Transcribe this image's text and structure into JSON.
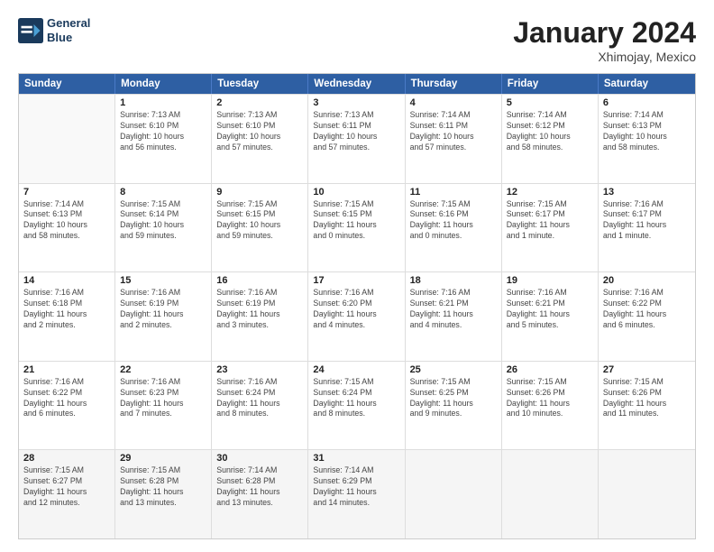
{
  "header": {
    "logo_line1": "General",
    "logo_line2": "Blue",
    "title": "January 2024",
    "subtitle": "Xhimojay, Mexico"
  },
  "days_of_week": [
    "Sunday",
    "Monday",
    "Tuesday",
    "Wednesday",
    "Thursday",
    "Friday",
    "Saturday"
  ],
  "weeks": [
    [
      {
        "day": "",
        "info": ""
      },
      {
        "day": "1",
        "info": "Sunrise: 7:13 AM\nSunset: 6:10 PM\nDaylight: 10 hours\nand 56 minutes."
      },
      {
        "day": "2",
        "info": "Sunrise: 7:13 AM\nSunset: 6:10 PM\nDaylight: 10 hours\nand 57 minutes."
      },
      {
        "day": "3",
        "info": "Sunrise: 7:13 AM\nSunset: 6:11 PM\nDaylight: 10 hours\nand 57 minutes."
      },
      {
        "day": "4",
        "info": "Sunrise: 7:14 AM\nSunset: 6:11 PM\nDaylight: 10 hours\nand 57 minutes."
      },
      {
        "day": "5",
        "info": "Sunrise: 7:14 AM\nSunset: 6:12 PM\nDaylight: 10 hours\nand 58 minutes."
      },
      {
        "day": "6",
        "info": "Sunrise: 7:14 AM\nSunset: 6:13 PM\nDaylight: 10 hours\nand 58 minutes."
      }
    ],
    [
      {
        "day": "7",
        "info": "Sunrise: 7:14 AM\nSunset: 6:13 PM\nDaylight: 10 hours\nand 58 minutes."
      },
      {
        "day": "8",
        "info": "Sunrise: 7:15 AM\nSunset: 6:14 PM\nDaylight: 10 hours\nand 59 minutes."
      },
      {
        "day": "9",
        "info": "Sunrise: 7:15 AM\nSunset: 6:15 PM\nDaylight: 10 hours\nand 59 minutes."
      },
      {
        "day": "10",
        "info": "Sunrise: 7:15 AM\nSunset: 6:15 PM\nDaylight: 11 hours\nand 0 minutes."
      },
      {
        "day": "11",
        "info": "Sunrise: 7:15 AM\nSunset: 6:16 PM\nDaylight: 11 hours\nand 0 minutes."
      },
      {
        "day": "12",
        "info": "Sunrise: 7:15 AM\nSunset: 6:17 PM\nDaylight: 11 hours\nand 1 minute."
      },
      {
        "day": "13",
        "info": "Sunrise: 7:16 AM\nSunset: 6:17 PM\nDaylight: 11 hours\nand 1 minute."
      }
    ],
    [
      {
        "day": "14",
        "info": "Sunrise: 7:16 AM\nSunset: 6:18 PM\nDaylight: 11 hours\nand 2 minutes."
      },
      {
        "day": "15",
        "info": "Sunrise: 7:16 AM\nSunset: 6:19 PM\nDaylight: 11 hours\nand 2 minutes."
      },
      {
        "day": "16",
        "info": "Sunrise: 7:16 AM\nSunset: 6:19 PM\nDaylight: 11 hours\nand 3 minutes."
      },
      {
        "day": "17",
        "info": "Sunrise: 7:16 AM\nSunset: 6:20 PM\nDaylight: 11 hours\nand 4 minutes."
      },
      {
        "day": "18",
        "info": "Sunrise: 7:16 AM\nSunset: 6:21 PM\nDaylight: 11 hours\nand 4 minutes."
      },
      {
        "day": "19",
        "info": "Sunrise: 7:16 AM\nSunset: 6:21 PM\nDaylight: 11 hours\nand 5 minutes."
      },
      {
        "day": "20",
        "info": "Sunrise: 7:16 AM\nSunset: 6:22 PM\nDaylight: 11 hours\nand 6 minutes."
      }
    ],
    [
      {
        "day": "21",
        "info": "Sunrise: 7:16 AM\nSunset: 6:22 PM\nDaylight: 11 hours\nand 6 minutes."
      },
      {
        "day": "22",
        "info": "Sunrise: 7:16 AM\nSunset: 6:23 PM\nDaylight: 11 hours\nand 7 minutes."
      },
      {
        "day": "23",
        "info": "Sunrise: 7:16 AM\nSunset: 6:24 PM\nDaylight: 11 hours\nand 8 minutes."
      },
      {
        "day": "24",
        "info": "Sunrise: 7:15 AM\nSunset: 6:24 PM\nDaylight: 11 hours\nand 8 minutes."
      },
      {
        "day": "25",
        "info": "Sunrise: 7:15 AM\nSunset: 6:25 PM\nDaylight: 11 hours\nand 9 minutes."
      },
      {
        "day": "26",
        "info": "Sunrise: 7:15 AM\nSunset: 6:26 PM\nDaylight: 11 hours\nand 10 minutes."
      },
      {
        "day": "27",
        "info": "Sunrise: 7:15 AM\nSunset: 6:26 PM\nDaylight: 11 hours\nand 11 minutes."
      }
    ],
    [
      {
        "day": "28",
        "info": "Sunrise: 7:15 AM\nSunset: 6:27 PM\nDaylight: 11 hours\nand 12 minutes."
      },
      {
        "day": "29",
        "info": "Sunrise: 7:15 AM\nSunset: 6:28 PM\nDaylight: 11 hours\nand 13 minutes."
      },
      {
        "day": "30",
        "info": "Sunrise: 7:14 AM\nSunset: 6:28 PM\nDaylight: 11 hours\nand 13 minutes."
      },
      {
        "day": "31",
        "info": "Sunrise: 7:14 AM\nSunset: 6:29 PM\nDaylight: 11 hours\nand 14 minutes."
      },
      {
        "day": "",
        "info": ""
      },
      {
        "day": "",
        "info": ""
      },
      {
        "day": "",
        "info": ""
      }
    ]
  ]
}
